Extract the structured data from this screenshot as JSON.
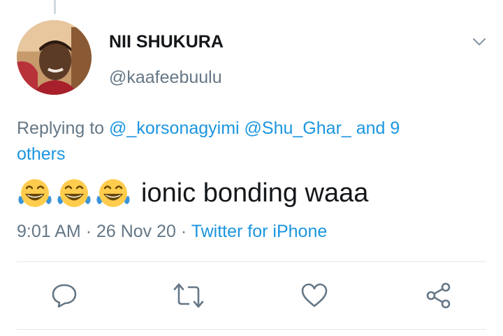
{
  "tweet": {
    "display_name": "NII SHUKURA",
    "handle": "@kaafeebuulu",
    "reply": {
      "prefix": "Replying to",
      "mention1": "@_korsonagyimi",
      "mention2": "@Shu_Ghar_",
      "others": "and 9 others"
    },
    "emojis": [
      "face-with-tears-of-joy",
      "face-with-tears-of-joy",
      "face-with-tears-of-joy"
    ],
    "text": "ionic bonding waaa",
    "time": "9:01 AM",
    "date": "26 Nov 20",
    "source": "Twitter for iPhone",
    "separator": "·"
  },
  "actions": [
    {
      "icon": "reply-icon"
    },
    {
      "icon": "retweet-icon"
    },
    {
      "icon": "like-icon"
    },
    {
      "icon": "share-icon"
    }
  ],
  "colors": {
    "link": "#1b95e0",
    "secondary_text": "#657786",
    "primary_text": "#14171a",
    "icon": "#657786",
    "divider": "#e1e8ed"
  }
}
